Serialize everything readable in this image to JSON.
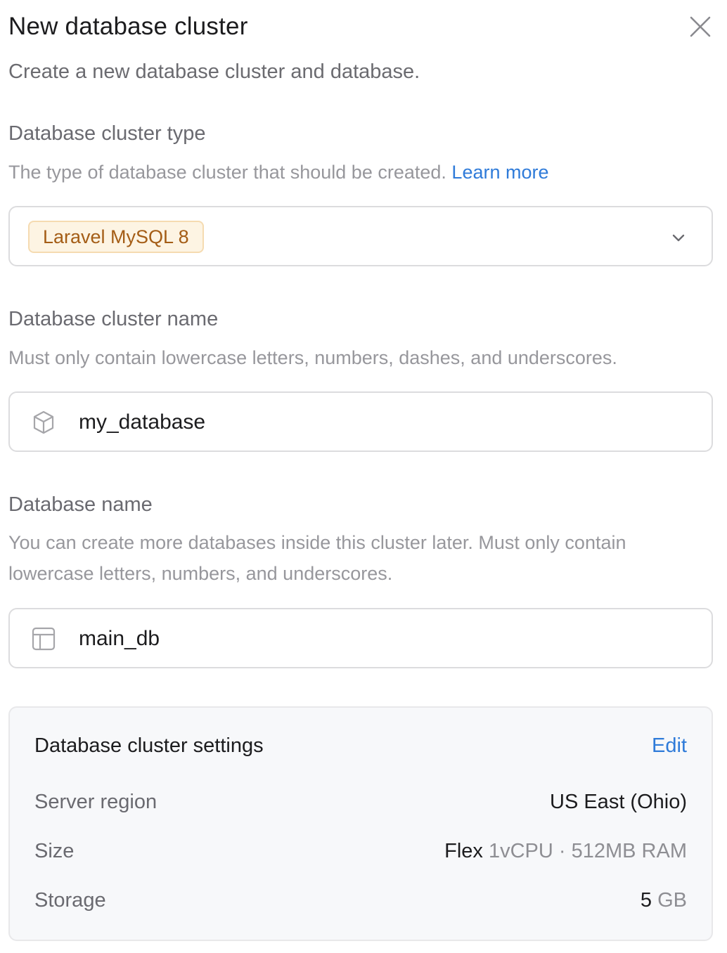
{
  "dialog": {
    "title": "New database cluster",
    "subtitle": "Create a new database cluster and database."
  },
  "cluster_type": {
    "label": "Database cluster type",
    "help": "The type of database cluster that should be created.",
    "help_link": "Learn more",
    "selected": "Laravel MySQL 8",
    "accent_color": "#a45d16"
  },
  "cluster_name": {
    "label": "Database cluster name",
    "help": "Must only contain lowercase letters, numbers, dashes, and underscores.",
    "value": "my_database",
    "icon": "cube-icon"
  },
  "database_name": {
    "label": "Database name",
    "help": "You can create more databases inside this cluster later. Must only contain lowercase letters, numbers, and underscores.",
    "value": "main_db",
    "icon": "table-icon"
  },
  "settings": {
    "title": "Database cluster settings",
    "edit_label": "Edit",
    "rows": [
      {
        "label": "Server region",
        "value": "US East (Ohio)"
      },
      {
        "label": "Size",
        "value_primary": "Flex",
        "value_secondary": "1vCPU · 512MB RAM"
      },
      {
        "label": "Storage",
        "value_primary": "5",
        "value_secondary": "GB"
      }
    ]
  },
  "colors": {
    "link": "#2f7bd9",
    "border": "#dcdcde",
    "panel_bg": "#f7f8fa"
  }
}
